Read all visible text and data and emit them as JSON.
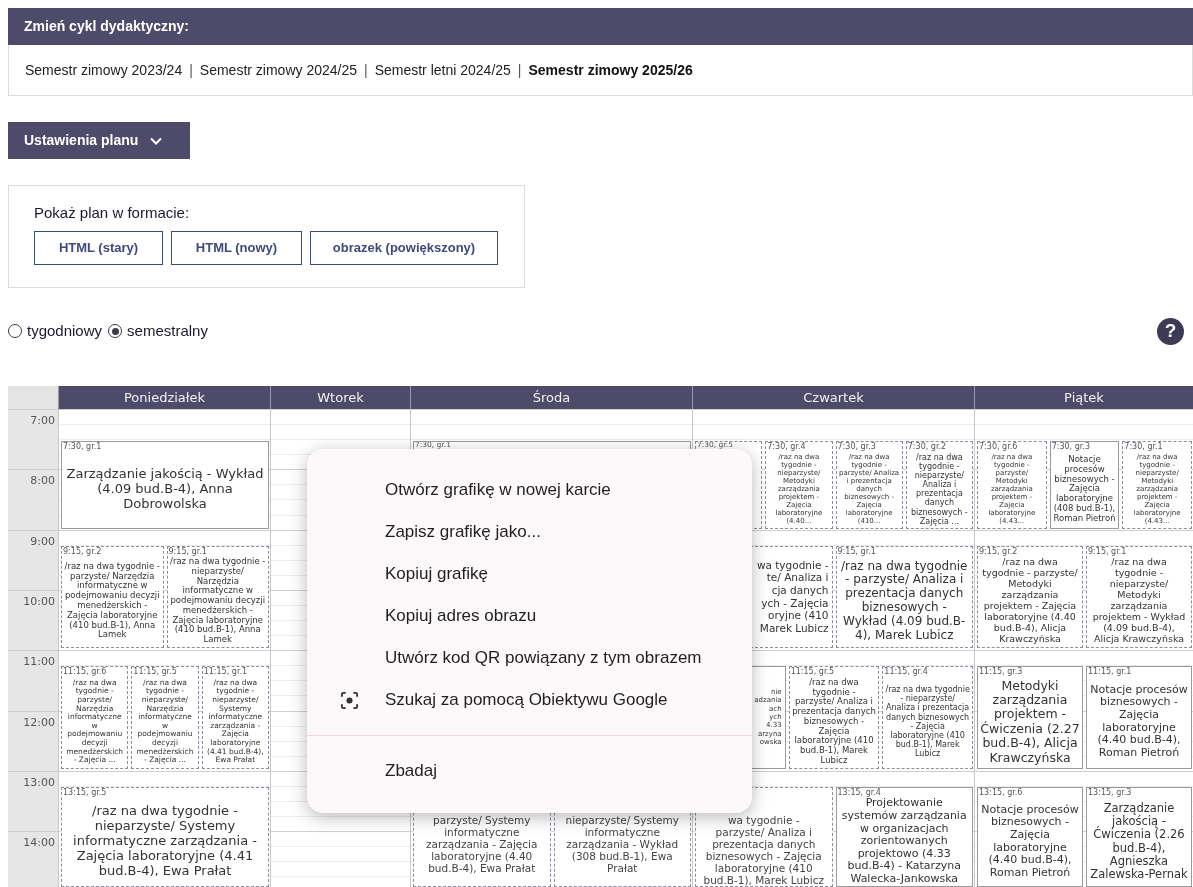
{
  "cycle_panel": {
    "title": "Zmień cykl dydaktyczny:",
    "separator": "|",
    "semesters": [
      {
        "label": "Semestr zimowy 2023/24",
        "selected": false
      },
      {
        "label": "Semestr zimowy 2024/25",
        "selected": false
      },
      {
        "label": "Semestr letni 2024/25",
        "selected": false
      },
      {
        "label": "Semestr zimowy 2025/26",
        "selected": true
      }
    ]
  },
  "settings_button": {
    "label": "Ustawienia planu"
  },
  "format_panel": {
    "title": "Pokaż plan w formacie:",
    "buttons": [
      "HTML (stary)",
      "HTML (nowy)",
      "obrazek (powiększony)"
    ]
  },
  "view_options": [
    {
      "label": "tygodniowy",
      "selected": false
    },
    {
      "label": "semestralny",
      "selected": true
    }
  ],
  "help": "?",
  "timetable": {
    "hours": [
      "7:00",
      "8:00",
      "9:00",
      "10:00",
      "11:00",
      "12:00",
      "13:00",
      "14:00"
    ],
    "days": [
      {
        "name": "Poniedziałek",
        "groups": [
          {
            "kind": "first",
            "events": [
              {
                "kind": "full",
                "label": "7:30, gr.1",
                "text": "Zarządzanie jakością - Wykład (4.09 bud.B-4), Anna Dobrowolska",
                "dashed": false
              }
            ]
          },
          {
            "kind": "second",
            "events": [
              {
                "kind": "full",
                "label": "9:15, gr.2",
                "text": "/raz na dwa tygodnie - parzyste/ Narzędzia informatyczne w podejmowaniu decyzji menedżerskich - Zajęcia laboratoryjne (410 bud.B-1), Anna Lamek",
                "dashed": true
              },
              {
                "kind": "full",
                "label": "9:15, gr.1",
                "text": "/raz na dwa tygodnie - nieparzyste/ Narzędzia informatyczne w podejmowaniu decyzji menedżerskich - Zajęcia laboratoryjne (410 bud.B-1), Anna Lamek",
                "dashed": true
              }
            ]
          },
          {
            "kind": "third",
            "events": [
              {
                "kind": "full",
                "label": "11:15, gr.6",
                "text": "/raz na dwa tygodnie - parzyste/ Narzędzia informatyczne w podejmowaniu decyzji menedżerskich - Zajęcia ...",
                "dashed": true
              },
              {
                "kind": "full",
                "label": "11:15, gr.5",
                "text": "/raz na dwa tygodnie - nieparzyste/ Narzędzia informatyczne w podejmowaniu decyzji menedżerskich - Zajęcia ...",
                "dashed": true
              },
              {
                "kind": "full",
                "label": "11:15, gr.1",
                "text": "/raz na dwa tygodnie - nieparzyste/ Systemy informatyczne zarządzania - Zajęcia laboratoryjne (4.41 bud.B-4), Ewa Prałat",
                "dashed": true
              }
            ]
          },
          {
            "kind": "fourth",
            "events": [
              {
                "kind": "full",
                "label": "13:15, gr.5",
                "text": "/raz na dwa tygodnie - nieparzyste/ Systemy informatyczne zarządzania - Zajęcia laboratoryjne (4.41 bud.B-4), Ewa Prałat",
                "dashed": true
              }
            ]
          }
        ]
      },
      {
        "name": "Wtorek"
      },
      {
        "name": "Środa",
        "groups": [
          {
            "kind": "first",
            "events": [
              {
                "kind": "label_only",
                "label": "7:30, gr.1",
                "dashed": false
              }
            ]
          },
          {
            "kind": "fourth",
            "events": [
              {
                "kind": "cut_top",
                "lines": [
                  "parzyste/ Systemy",
                  "informatyczne",
                  "zarządzania - Zajęcia",
                  "laboratoryjne (4.40",
                  "bud.B-4), Ewa Prałat"
                ],
                "dashed": true
              },
              {
                "kind": "cut_top",
                "lines": [
                  "nieparzyste/ Systemy",
                  "informatyczne",
                  "zarządzania - Wykład",
                  "(308 bud.B-1), Ewa",
                  "Prałat"
                ],
                "dashed": true
              }
            ]
          }
        ]
      },
      {
        "name": "Czwartek",
        "groups": [
          {
            "kind": "first",
            "events": [
              {
                "kind": "label_only",
                "label": "7:30, gr.5",
                "dashed": true
              },
              {
                "kind": "full",
                "label": "7:30, gr.4",
                "text": "/raz na dwa tygodnie - nieparzyste/ Metodyki zarządzania projektem - Zajęcia laboratoryjne (4.40...",
                "dashed": true
              },
              {
                "kind": "full",
                "label": "7:30, gr.3",
                "text": "/raz na dwa tygodnie - parzyste/ Analiza i prezentacja danych biznesowych - Zajęcia laboratoryjne (410...",
                "dashed": true
              },
              {
                "kind": "full",
                "label": "7:30, gr.2",
                "text": "/raz na dwa tygodnie - nieparzyste/ Analiza i prezentacja danych biznesowych - Zajęcia ...",
                "dashed": true
              }
            ]
          },
          {
            "kind": "second",
            "events": [
              {
                "kind": "cut_left",
                "lines": [
                  "wa tygodnie -",
                  "te/ Analiza i",
                  "cja danych",
                  "ych - Zajęcia",
                  "oryjne (410",
                  "Marek Lubicz"
                ],
                "dashed": true
              },
              {
                "kind": "full",
                "label": "9:15, gr.1",
                "text": "/raz na dwa tygodnie - parzyste/ Analiza i prezentacja danych biznesowych - Wykład (4.09 bud.B-4), Marek Lubicz",
                "dashed": true
              }
            ]
          },
          {
            "kind": "third",
            "events": [
              {
                "kind": "cut_left",
                "lines": [
                  "nie",
                  "adzania",
                  "ach",
                  "ych",
                  "4.33",
                  "arzyna",
                  "owska"
                ],
                "dashed": false
              },
              {
                "kind": "full",
                "label": "11:15, gr.5",
                "text": "/raz na dwa tygodnie - parzyste/ Analiza i prezentacja danych biznesowych - Zajęcia laboratoryjne (410 bud.B-1), Marek Lubicz",
                "dashed": true
              },
              {
                "kind": "full",
                "label": "11:15, gr.4",
                "text": "/raz na dwa tygodnie - nieparzyste/ Analiza i prezentacja danych biznesowych - Zajęcia laboratoryjne (410 bud.B-1), Marek Lubicz",
                "dashed": true
              }
            ]
          },
          {
            "kind": "fourth",
            "events": [
              {
                "kind": "cut_top",
                "lines": [
                  "wa tygodnie -",
                  "parzyste/ Analiza i",
                  "prezentacja danych",
                  "biznesowych - Zajęcia",
                  "laboratoryjne (410",
                  "bud.B-1), Marek Lubicz"
                ],
                "dashed": true
              },
              {
                "kind": "full",
                "label": "13:15, gr.4",
                "text": "Projektowanie systemów zarządzania w organizacjach zorientowanych projektowo (4.33 bud.B-4) - Katarzyna Walecka-Jankowska",
                "dashed": false
              }
            ]
          }
        ]
      },
      {
        "name": "Piątek",
        "groups": [
          {
            "kind": "first",
            "events": [
              {
                "kind": "full",
                "label": "7:30, gr.6",
                "text": "/raz na dwa tygodnie - parzyste/ Metodyki zarządzania projektem - Zajęcia laboratoryjne (4.43...",
                "dashed": true
              },
              {
                "kind": "full",
                "label": "7:30, gr.3",
                "text": "Notacje procesów biznesowych - Zajęcia laboratoryjne (408 bud.B-1), Roman Pietroń",
                "dashed": false
              },
              {
                "kind": "full",
                "label": "7:30, gr.1",
                "text": "/raz na dwa tygodnie - nieparzyste/ Metodyki zarządzania projektem - Zajęcia laboratoryjne (4.43...",
                "dashed": true
              }
            ]
          },
          {
            "kind": "second",
            "events": [
              {
                "kind": "full",
                "label": "9:15, gr.2",
                "text": "/raz na dwa tygodnie - parzyste/ Metodyki zarządzania projektem - Zajęcia laboratoryjne (4.40 bud.B-4), Alicja Krawczyńska",
                "dashed": true
              },
              {
                "kind": "full",
                "label": "9:15, gr.1",
                "text": "/raz na dwa tygodnie - nieparzyste/ Metodyki zarządzania projektem - Wykład (4.09 bud.B-4), Alicja Krawczyńska",
                "dashed": true
              }
            ]
          },
          {
            "kind": "third",
            "events": [
              {
                "kind": "full",
                "label": "11:15, gr.3",
                "text": "Metodyki zarządzania projektem - Ćwiczenia (2.27 bud.B-4), Alicja Krawczyńska",
                "dashed": false
              },
              {
                "kind": "full",
                "label": "11:15, gr.1",
                "text": "Notacje procesów biznesowych - Zajęcia laboratoryjne (4.40 bud.B-4), Roman Pietroń",
                "dashed": false
              }
            ]
          },
          {
            "kind": "fourth",
            "events": [
              {
                "kind": "full",
                "label": "13:15, gr.6",
                "text": "Notacje procesów biznesowych - Zajęcia laboratoryjne (4.40 bud.B-4), Roman Pietroń",
                "dashed": false
              },
              {
                "kind": "full",
                "label": "13:15, gr.3",
                "text": "Zarządzanie jakością - Ćwiczenia (2.26 bud.B-4), Agnieszka Zalewska-Pernak",
                "dashed": false
              }
            ]
          }
        ]
      }
    ]
  },
  "context_menu": {
    "items": [
      {
        "kind": "plain",
        "label": "Otwórz grafikę w nowej karcie",
        "divider_before": false
      },
      {
        "kind": "plain",
        "label": "Zapisz grafikę jako...",
        "divider_before": false
      },
      {
        "kind": "plain",
        "label": "Kopiuj grafikę",
        "divider_before": false
      },
      {
        "kind": "plain",
        "label": "Kopiuj adres obrazu",
        "divider_before": false
      },
      {
        "kind": "plain",
        "label": "Utwórz kod QR powiązany z tym obrazem",
        "divider_before": false
      },
      {
        "kind": "lens",
        "label": "Szukaj za pomocą Obiektywu Google",
        "divider_before": false
      },
      {
        "kind": "plain",
        "label": "Zbadaj",
        "divider_before": true
      }
    ]
  }
}
